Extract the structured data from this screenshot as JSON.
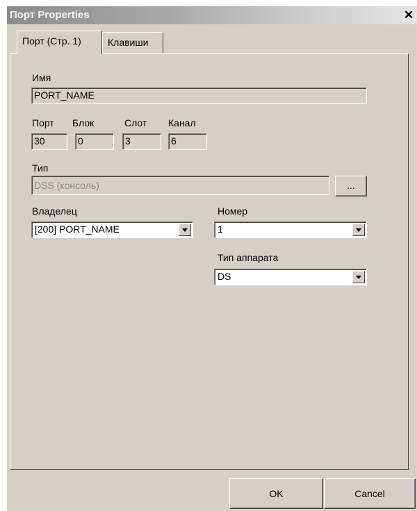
{
  "window": {
    "title": "Порт Properties",
    "close_glyph": "✕"
  },
  "tabs": [
    {
      "label": "Порт (Стр. 1)",
      "active": true
    },
    {
      "label": "Клавиши",
      "active": false
    }
  ],
  "form": {
    "name": {
      "label": "Имя",
      "value": "PORT_NAME"
    },
    "port": {
      "label": "Порт",
      "value": "30"
    },
    "block": {
      "label": "Блок",
      "value": "0"
    },
    "slot": {
      "label": "Слот",
      "value": "3"
    },
    "channel": {
      "label": "Канал",
      "value": "6"
    },
    "type": {
      "label": "Тип",
      "value": "DSS (консоль)",
      "browse_label": "..."
    },
    "owner": {
      "label": "Владелец",
      "value": "[200] PORT_NAME"
    },
    "number": {
      "label": "Номер",
      "value": "1"
    },
    "device_type": {
      "label": "Тип аппарата",
      "value": "DS"
    }
  },
  "buttons": {
    "ok": "OK",
    "cancel": "Cancel"
  }
}
